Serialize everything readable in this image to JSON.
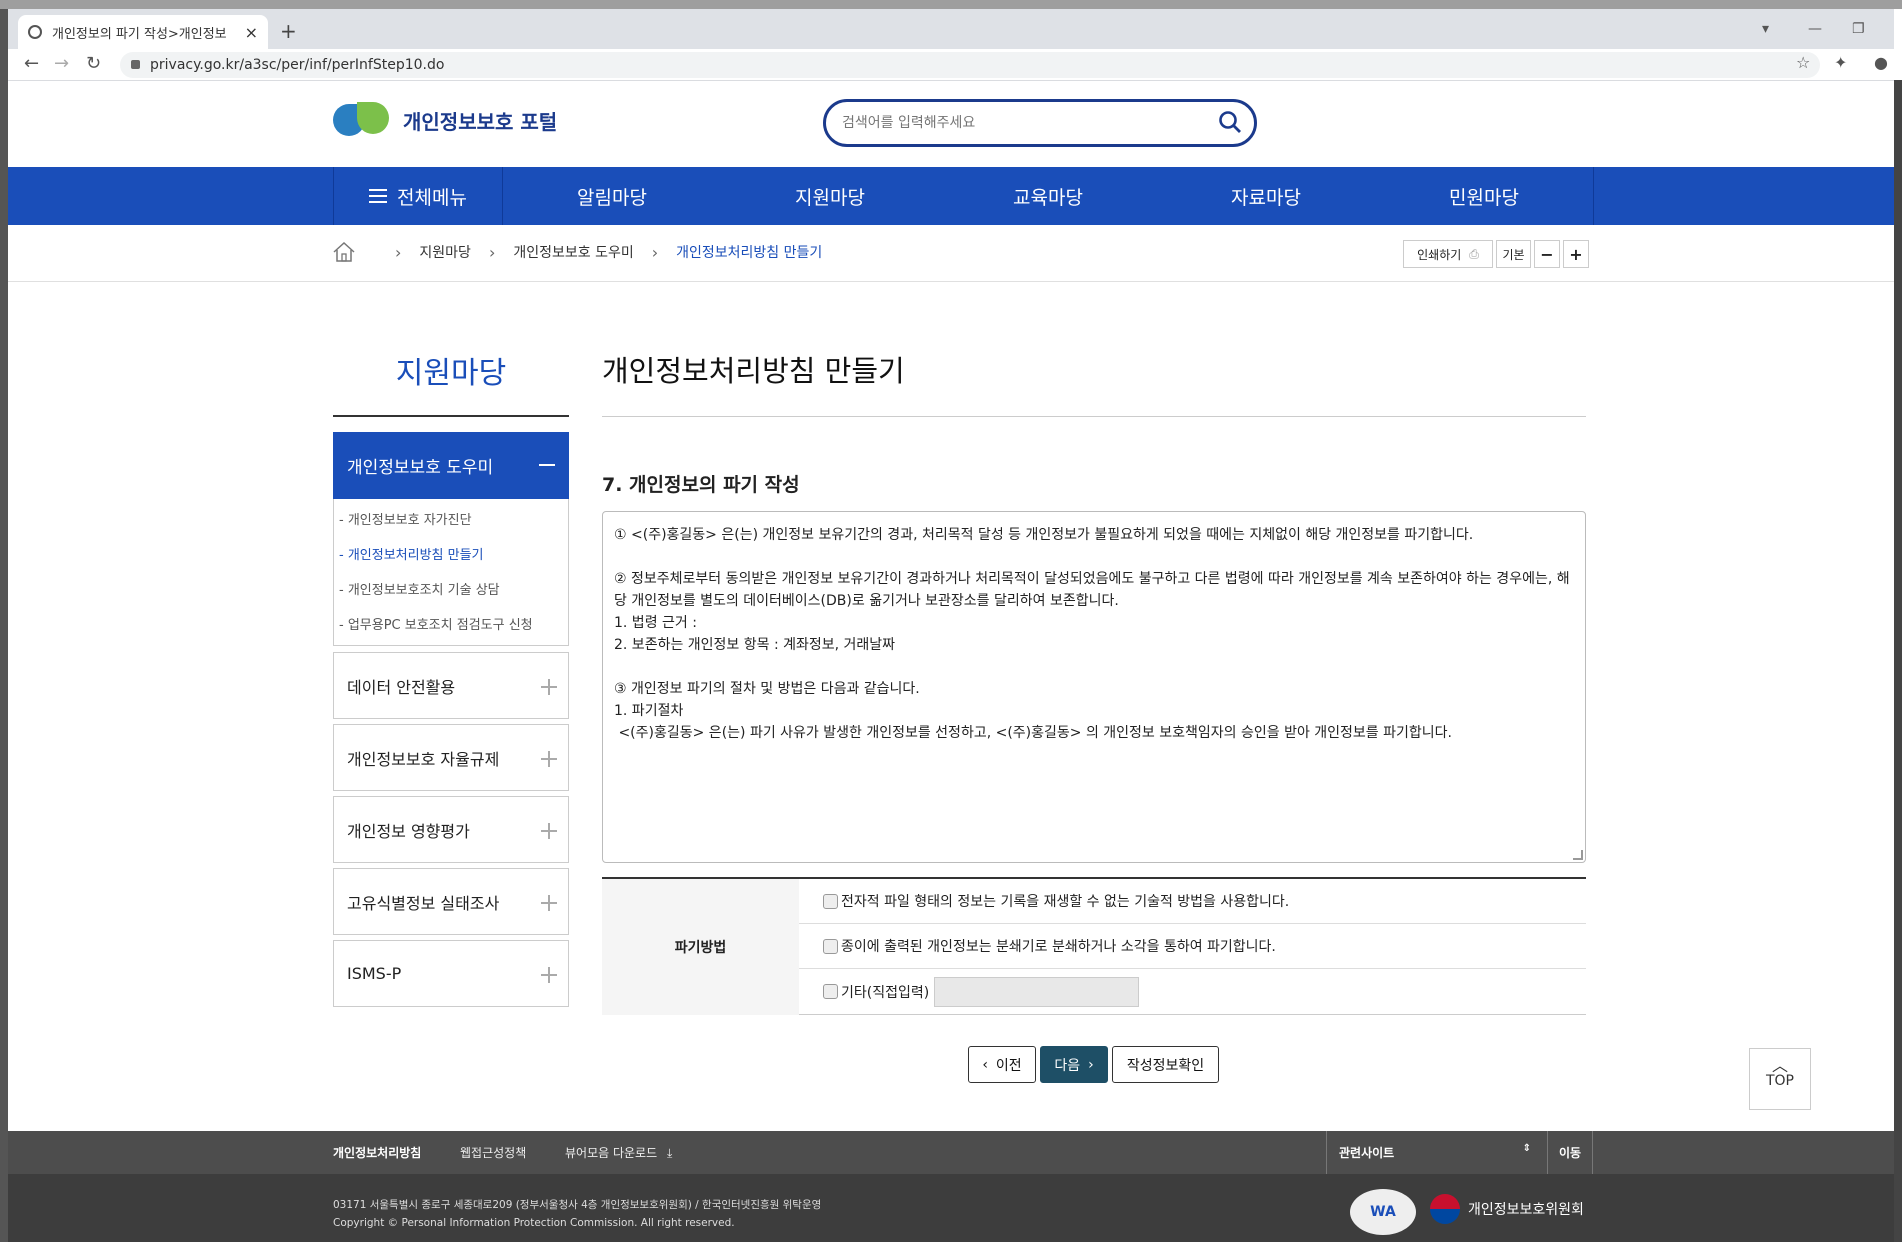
{
  "browser": {
    "tab_title": "개인정보의 파기 작성>개인정보",
    "url": "privacy.go.kr/a3sc/per/inf/perInfStep10.do"
  },
  "header": {
    "logo_text": "개인정보보호 포털",
    "search_placeholder": "검색어를 입력해주세요"
  },
  "gnb": {
    "all_menu": "전체메뉴",
    "items": [
      "알림마당",
      "지원마당",
      "교육마당",
      "자료마당",
      "민원마당"
    ]
  },
  "breadcrumb": {
    "items": [
      "지원마당",
      "개인정보보호 도우미",
      "개인정보처리방침 만들기"
    ]
  },
  "tools": {
    "print": "인쇄하기",
    "default": "기본",
    "minus": "−",
    "plus": "+"
  },
  "lnb": {
    "title": "지원마당",
    "active": "개인정보보호 도우미",
    "sub_items": [
      "개인정보보호 자가진단",
      "개인정보처리방침 만들기",
      "개인정보보호조치 기술 상담",
      "업무용PC 보호조치 점검도구 신청"
    ],
    "boxes": [
      "데이터 안전활용",
      "개인정보보호 자율규제",
      "개인정보 영향평가",
      "고유식별정보 실태조사",
      "ISMS-P"
    ]
  },
  "main": {
    "page_title": "개인정보처리방침 만들기",
    "section_title": "7. 개인정보의 파기 작성",
    "policy_text": "① <(주)홍길동> 은(는) 개인정보 보유기간의 경과, 처리목적 달성 등 개인정보가 불필요하게 되었을 때에는 지체없이 해당 개인정보를 파기합니다.\n\n② 정보주체로부터 동의받은 개인정보 보유기간이 경과하거나 처리목적이 달성되었음에도 불구하고 다른 법령에 따라 개인정보를 계속 보존하여야 하는 경우에는, 해당 개인정보를 별도의 데이터베이스(DB)로 옮기거나 보관장소를 달리하여 보존합니다.\n1. 법령 근거 :\n2. 보존하는 개인정보 항목 : 계좌정보, 거래날짜\n\n③ 개인정보 파기의 절차 및 방법은 다음과 같습니다.\n1. 파기절차\n <(주)홍길동> 은(는) 파기 사유가 발생한 개인정보를 선정하고, <(주)홍길동> 의 개인정보 보호책임자의 승인을 받아 개인정보를 파기합니다.",
    "method_label": "파기방법",
    "methods": [
      "전자적 파일 형태의 정보는 기록을 재생할 수 없는 기술적 방법을 사용합니다.",
      "종이에 출력된 개인정보는 분쇄기로 분쇄하거나 소각을 통하여 파기합니다.",
      "기타(직접입력)"
    ],
    "buttons": {
      "prev": "이전",
      "next": "다음",
      "confirm": "작성정보확인"
    },
    "top": "TOP"
  },
  "footer": {
    "links": [
      "개인정보처리방침",
      "웹접근성정책",
      "뷰어모음 다운로드"
    ],
    "related_site": "관련사이트",
    "go": "이동",
    "address": "03171 서울특별시 종로구 세종대로209 (정부서울청사 4층 개인정보보호위원회) / 한국인터넷진흥원 위탁운영",
    "copyright": "Copyright © Personal Information Protection Commission. All right reserved.",
    "wa_mark": "WA",
    "pipc": "개인정보보호위원회"
  },
  "colors": {
    "brand_blue": "#1a4eb9",
    "button_dark": "#1e4f66",
    "footer_bg": "#3d3d3d"
  }
}
